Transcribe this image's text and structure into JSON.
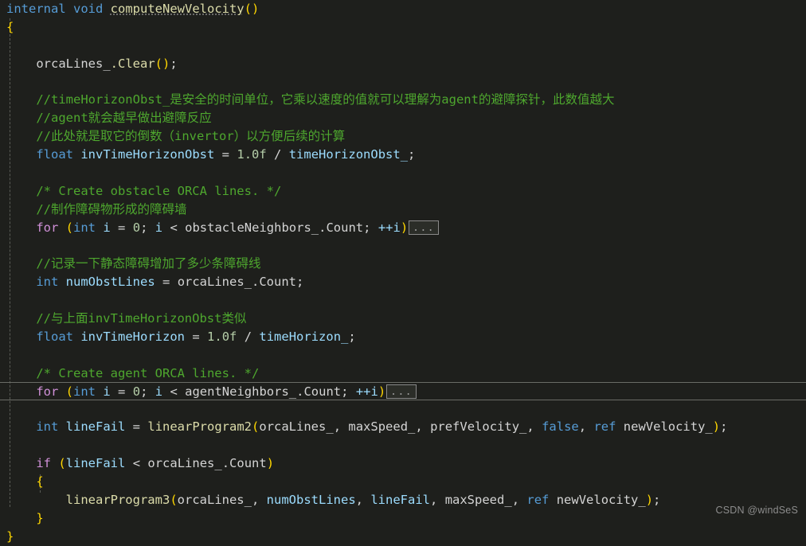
{
  "editor": {
    "language": "csharp",
    "theme": "dark-plus",
    "background_color": "#1e1f1c",
    "current_line_index": 20,
    "watermark": "CSDN @windSeS",
    "fold_marker": "...",
    "lines": [
      {
        "i": 0,
        "text": "internal void computeNewVelocity()"
      },
      {
        "i": 1,
        "text": "{"
      },
      {
        "i": 2,
        "text": ""
      },
      {
        "i": 3,
        "text": "    orcaLines_.Clear();"
      },
      {
        "i": 4,
        "text": ""
      },
      {
        "i": 5,
        "text": "    //timeHorizonObst_是安全的时间单位，它乘以速度的值就可以理解为agent的避障探针，此数值越大"
      },
      {
        "i": 6,
        "text": "    //agent就会越早做出避障反应"
      },
      {
        "i": 7,
        "text": "    //此处就是取它的倒数（invertor）以方便后续的计算"
      },
      {
        "i": 8,
        "text": "    float invTimeHorizonObst = 1.0f / timeHorizonObst_;"
      },
      {
        "i": 9,
        "text": ""
      },
      {
        "i": 10,
        "text": "    /* Create obstacle ORCA lines. */"
      },
      {
        "i": 11,
        "text": "    //制作障碍物形成的障碍墙"
      },
      {
        "i": 12,
        "text": "    for (int i = 0; i < obstacleNeighbors_.Count; ++i)..."
      },
      {
        "i": 13,
        "text": ""
      },
      {
        "i": 14,
        "text": "    //记录一下静态障碍增加了多少条障碍线"
      },
      {
        "i": 15,
        "text": "    int numObstLines = orcaLines_.Count;"
      },
      {
        "i": 16,
        "text": ""
      },
      {
        "i": 17,
        "text": "    //与上面invTimeHorizonObst类似"
      },
      {
        "i": 18,
        "text": "    float invTimeHorizon = 1.0f / timeHorizon_;"
      },
      {
        "i": 19,
        "text": ""
      },
      {
        "i": 20,
        "text": "    /* Create agent ORCA lines. */"
      },
      {
        "i": 21,
        "text": "    for (int i = 0; i < agentNeighbors_.Count; ++i)..."
      },
      {
        "i": 22,
        "text": ""
      },
      {
        "i": 23,
        "text": "    int lineFail = linearProgram2(orcaLines_, maxSpeed_, prefVelocity_, false, ref newVelocity_);"
      },
      {
        "i": 24,
        "text": ""
      },
      {
        "i": 25,
        "text": "    if (lineFail < orcaLines_.Count)"
      },
      {
        "i": 26,
        "text": "    {"
      },
      {
        "i": 27,
        "text": "        linearProgram3(orcaLines_, numObstLines, lineFail, maxSpeed_, ref newVelocity_);"
      },
      {
        "i": 28,
        "text": "    }"
      },
      {
        "i": 29,
        "text": "}"
      }
    ],
    "tokens": {
      "t_internal": "internal",
      "t_void": "void",
      "t_computeNewVelocity": "computeNewVelocity",
      "t_paren_open": "(",
      "t_paren_close": ")",
      "t_brace_open": "{",
      "t_brace_close": "}",
      "t_orcaLines": "orcaLines_",
      "t_dot_Clear": ".Clear",
      "t_semicolon": ";",
      "t_comment_1": "//timeHorizonObst_是安全的时间单位，它乘以速度的值就可以理解为agent的避障探针，此数值越大",
      "t_comment_2": "//agent就会越早做出避障反应",
      "t_comment_3": "//此处就是取它的倒数（invertor）以方便后续的计算",
      "t_float": "float",
      "t_invTimeHorizonObst": "invTimeHorizonObst",
      "t_eq": "=",
      "t_1_0f": "1.0f",
      "t_slash": "/",
      "t_timeHorizonObst_": "timeHorizonObst_",
      "t_comment_obstacle_orca": "/* Create obstacle ORCA lines. */",
      "t_comment_4": "//制作障碍物形成的障碍墙",
      "t_for": "for",
      "t_int": "int",
      "t_i": "i",
      "t_zero": "0",
      "t_lt": "<",
      "t_obstacleNeighbors": "obstacleNeighbors_",
      "t_dot_Count": ".Count",
      "t_plusplus_i": "++i",
      "t_comment_5": "//记录一下静态障碍增加了多少条障碍线",
      "t_numObstLines": "numObstLines",
      "t_comment_6": "//与上面invTimeHorizonObst类似",
      "t_invTimeHorizon": "invTimeHorizon",
      "t_timeHorizon_": "timeHorizon_",
      "t_comment_agent_orca": "/* Create agent ORCA lines. */",
      "t_agentNeighbors": "agentNeighbors_",
      "t_lineFail": "lineFail",
      "t_linearProgram2": "linearProgram2",
      "t_maxSpeed": "maxSpeed_",
      "t_prefVelocity": "prefVelocity_",
      "t_false": "false",
      "t_ref": "ref",
      "t_newVelocity": "newVelocity_",
      "t_if": "if",
      "t_linearProgram3": "linearProgram3",
      "t_comma": ",",
      "t_semi": ";"
    },
    "colors": {
      "background": "#1e1f1c",
      "foreground": "#d4d4d4",
      "keyword": "#569cd6",
      "control_keyword": "#d191d9",
      "method": "#dcdcaa",
      "variable": "#9cdcfe",
      "number": "#b5cea8",
      "comment": "#4ea72e",
      "bracket_level_1": "#ffd700",
      "indent_guide": "#5a5c56",
      "current_line_border": "#6a6c66",
      "fold_chip_border": "#8a8a8a",
      "watermark": "#8d8d8d"
    }
  }
}
